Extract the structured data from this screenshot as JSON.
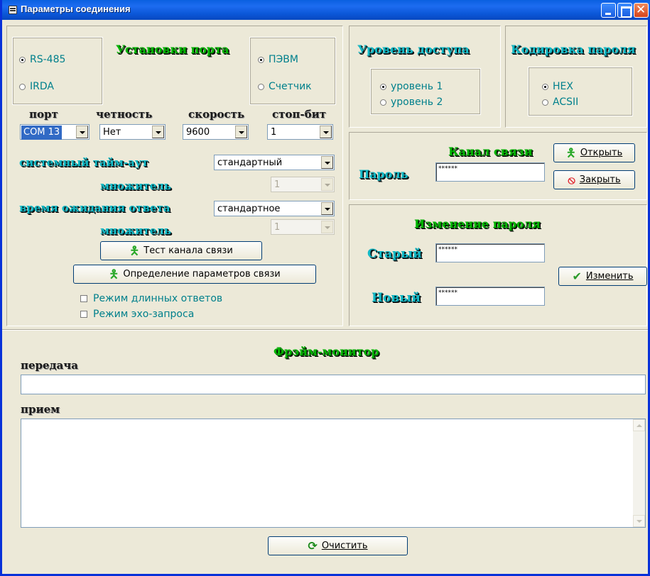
{
  "window": {
    "title": "Параметры соединения"
  },
  "port_settings": {
    "heading": "Установки порта",
    "interface_options": [
      {
        "label": "RS-485",
        "selected": true
      },
      {
        "label": "IRDA",
        "selected": false
      }
    ],
    "source_options": [
      {
        "label": "ПЭВМ",
        "selected": true
      },
      {
        "label": "Счетчик",
        "selected": false
      }
    ],
    "port_label": "порт",
    "port_value": "COM 13",
    "parity_label": "четность",
    "parity_value": "Нет",
    "speed_label": "скорость",
    "speed_value": "9600",
    "stopbits_label": "стоп-бит",
    "stopbits_value": "1",
    "system_timeout_label": "системный тайм-аут",
    "system_timeout_value": "стандартный",
    "multiplier_label": "множитель",
    "multiplier1_value": "1",
    "response_wait_label": "время ожидания ответа",
    "response_wait_value": "стандартное",
    "multiplier2_value": "1",
    "test_button": "Тест канала связи",
    "detect_button": "Определение параметров связи",
    "long_answers_label": "Режим длинных ответов",
    "echo_mode_label": "Режим эхо-запроса"
  },
  "access_level": {
    "heading": "Уровень доступа",
    "options": [
      {
        "label": "уровень 1",
        "selected": true
      },
      {
        "label": "уровень 2",
        "selected": false
      }
    ]
  },
  "password_encoding": {
    "heading": "Кодировка пароля",
    "options": [
      {
        "label": "HEX",
        "selected": true
      },
      {
        "label": "ACSII",
        "selected": false
      }
    ]
  },
  "channel": {
    "heading": "Канал связи",
    "password_label": "Пароль",
    "password_value": "******",
    "open_button": "Открыть",
    "close_button": "Закрыть"
  },
  "password_change": {
    "heading": "Изменение пароля",
    "old_label": "Старый",
    "old_value": "******",
    "new_label": "Новый",
    "new_value": "******",
    "change_button": "Изменить"
  },
  "frame_monitor": {
    "heading": "Фрэйм-монитор",
    "transmit_label": "передача",
    "transmit_value": "",
    "receive_label": "прием",
    "receive_value": "",
    "clear_button": "Очистить"
  },
  "icons": {
    "app": "window-menu-icon",
    "run": "running-man-icon",
    "stop": "stop-icon",
    "check": "checkmark-icon",
    "refresh": "refresh-icon"
  },
  "colors": {
    "titlebar": "#0a5fe0",
    "label_teal": "#00808c",
    "heading_green": "#00a000",
    "heading_cyan": "#11b9c6",
    "face": "#ece9d8"
  }
}
